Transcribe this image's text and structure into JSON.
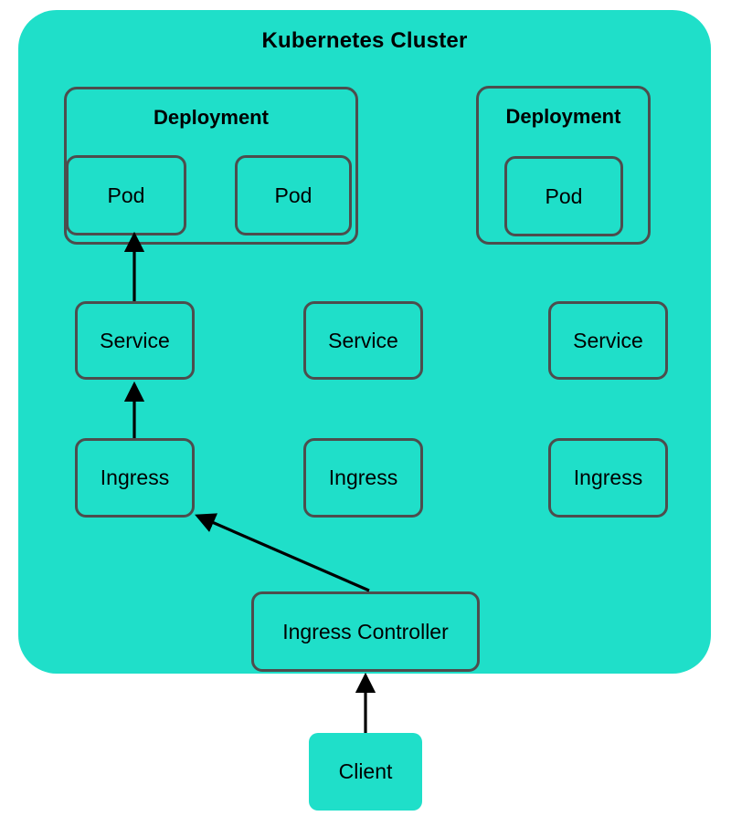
{
  "diagram": {
    "title": "Kubernetes Cluster",
    "colors": {
      "cluster_fill": "#1FDFC9",
      "node_fill": "#1FDFC9",
      "node_stroke": "#4D4D4D",
      "text": "#000000",
      "arrow": "#000000",
      "page_background": "#FFFFFF"
    },
    "groups": [
      {
        "id": "deployment-1",
        "label": "Deployment"
      },
      {
        "id": "deployment-2",
        "label": "Deployment"
      }
    ],
    "nodes": [
      {
        "id": "pod-1",
        "label": "Pod"
      },
      {
        "id": "pod-2",
        "label": "Pod"
      },
      {
        "id": "pod-3",
        "label": "Pod"
      },
      {
        "id": "service-1",
        "label": "Service"
      },
      {
        "id": "service-2",
        "label": "Service"
      },
      {
        "id": "service-3",
        "label": "Service"
      },
      {
        "id": "ingress-1",
        "label": "Ingress"
      },
      {
        "id": "ingress-2",
        "label": "Ingress"
      },
      {
        "id": "ingress-3",
        "label": "Ingress"
      },
      {
        "id": "ingress-controller",
        "label": "Ingress Controller"
      },
      {
        "id": "client",
        "label": "Client"
      }
    ],
    "edges": [
      {
        "from": "service-1",
        "to": "pod-1",
        "style": "solid-arrow"
      },
      {
        "from": "ingress-1",
        "to": "service-1",
        "style": "solid-arrow"
      },
      {
        "from": "ingress-controller",
        "to": "ingress-1",
        "style": "solid-arrow"
      },
      {
        "from": "client",
        "to": "ingress-controller",
        "style": "solid-arrow"
      }
    ]
  }
}
